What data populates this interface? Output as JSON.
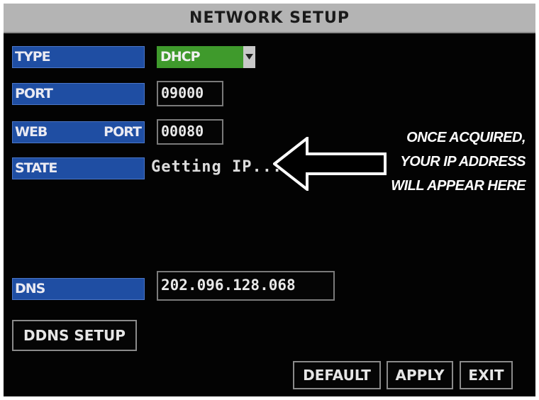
{
  "title": "NETWORK SETUP",
  "rows": {
    "type": {
      "label": "TYPE",
      "value": "DHCP"
    },
    "port": {
      "label": "PORT",
      "value": "09000"
    },
    "web_port": {
      "label_left": "WEB",
      "label_right": "PORT",
      "value": "00080"
    },
    "state": {
      "label": "STATE",
      "value": "Getting IP..."
    },
    "dns": {
      "label": "DNS",
      "value": "202.096.128.068"
    }
  },
  "buttons": {
    "ddns_setup": "DDNS SETUP",
    "default": "DEFAULT",
    "apply": "APPLY",
    "exit": "EXIT"
  },
  "annotation": {
    "line1": "ONCE ACQUIRED,",
    "line2": "YOUR IP ADDRESS",
    "line3": "WILL APPEAR HERE"
  },
  "colors": {
    "screen_bg": "#030303",
    "titlebar": "#b4b4b4",
    "label_blue": "#1f4ea3",
    "select_green": "#3f9a2c"
  },
  "icons": {
    "dropdown": "chevron-down-icon",
    "pointer": "left-arrow-icon"
  }
}
